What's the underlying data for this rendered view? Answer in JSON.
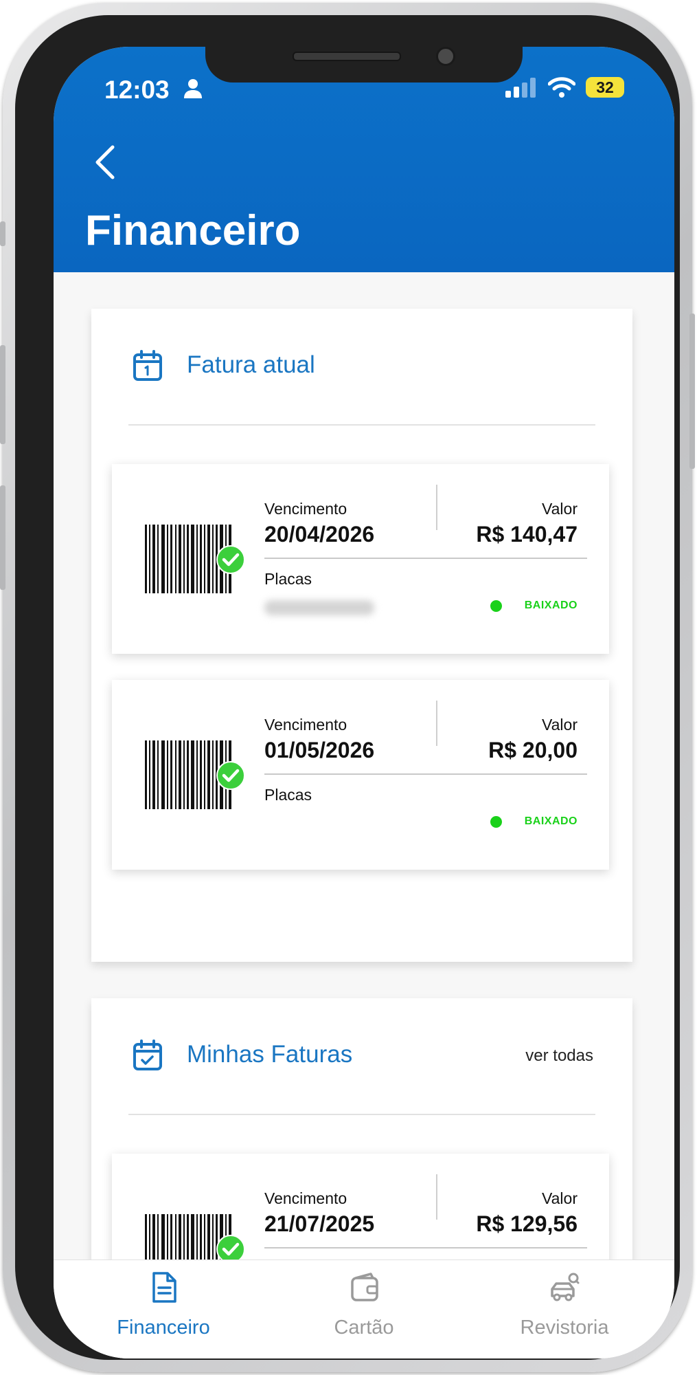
{
  "status_bar": {
    "time": "12:03",
    "battery": "32"
  },
  "header": {
    "title": "Financeiro"
  },
  "sections": {
    "current": {
      "title": "Fatura atual",
      "invoices": [
        {
          "due_label": "Vencimento",
          "due_date": "20/04/2026",
          "amount_label": "Valor",
          "amount": "R$ 140,47",
          "plates_label": "Placas",
          "status": "BAIXADO"
        },
        {
          "due_label": "Vencimento",
          "due_date": "01/05/2026",
          "amount_label": "Valor",
          "amount": "R$ 20,00",
          "plates_label": "Placas",
          "status": "BAIXADO"
        }
      ]
    },
    "mine": {
      "title": "Minhas Faturas",
      "see_all": "ver todas",
      "invoices": [
        {
          "due_label": "Vencimento",
          "due_date": "21/07/2025",
          "amount_label": "Valor",
          "amount": "R$ 129,56"
        }
      ]
    }
  },
  "bottom_nav": [
    {
      "label": "Financeiro",
      "icon": "document-icon",
      "active": true
    },
    {
      "label": "Cartão",
      "icon": "wallet-icon",
      "active": false
    },
    {
      "label": "Revistoria",
      "icon": "car-search-icon",
      "active": false
    }
  ],
  "colors": {
    "header_blue": "#0c71c9",
    "accent_blue": "#1a76c2",
    "status_green": "#1ad11a",
    "check_green": "#3ccf3c",
    "inactive_gray": "#9a9a9a"
  }
}
